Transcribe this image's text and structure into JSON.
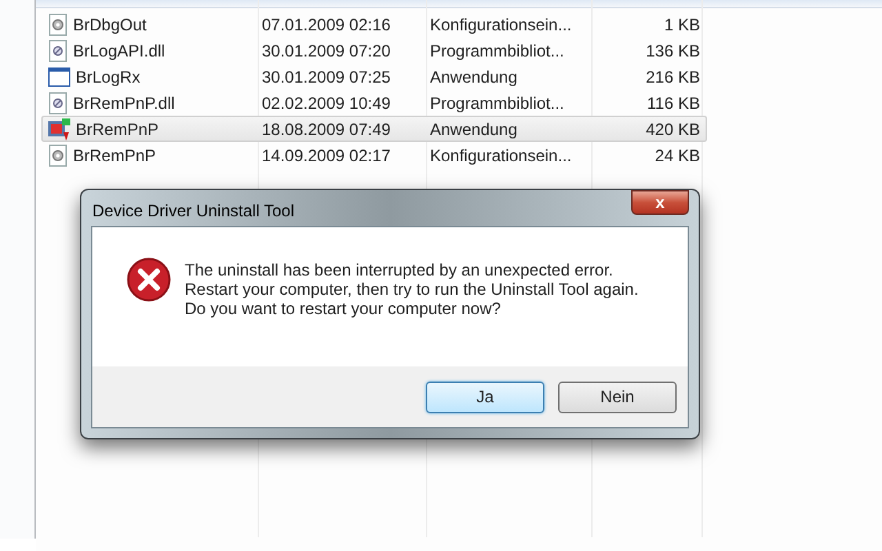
{
  "files": [
    {
      "name": "BrDbgOut",
      "date": "07.01.2009 02:16",
      "type": "Konfigurationsein...",
      "size": "1 KB",
      "kind": "config",
      "selected": false
    },
    {
      "name": "BrLogAPI.dll",
      "date": "30.01.2009 07:20",
      "type": "Programmbibliot...",
      "size": "136 KB",
      "kind": "library",
      "selected": false
    },
    {
      "name": "BrLogRx",
      "date": "30.01.2009 07:25",
      "type": "Anwendung",
      "size": "216 KB",
      "kind": "window",
      "selected": false
    },
    {
      "name": "BrRemPnP.dll",
      "date": "02.02.2009 10:49",
      "type": "Programmbibliot...",
      "size": "116 KB",
      "kind": "library",
      "selected": false
    },
    {
      "name": "BrRemPnP",
      "date": "18.08.2009 07:49",
      "type": "Anwendung",
      "size": "420 KB",
      "kind": "program",
      "selected": true
    },
    {
      "name": "BrRemPnP",
      "date": "14.09.2009 02:17",
      "type": "Konfigurationsein...",
      "size": "24 KB",
      "kind": "config",
      "selected": false
    }
  ],
  "dialog": {
    "title": "Device Driver Uninstall Tool",
    "close": "x",
    "message": [
      "The uninstall has been interrupted by an unexpected error.",
      "Restart your computer, then try to run the Uninstall Tool again.",
      "Do you want to restart your computer now?"
    ],
    "buttons": [
      {
        "label": "Ja",
        "selected": true
      },
      {
        "label": "Nein",
        "selected": false
      }
    ]
  }
}
